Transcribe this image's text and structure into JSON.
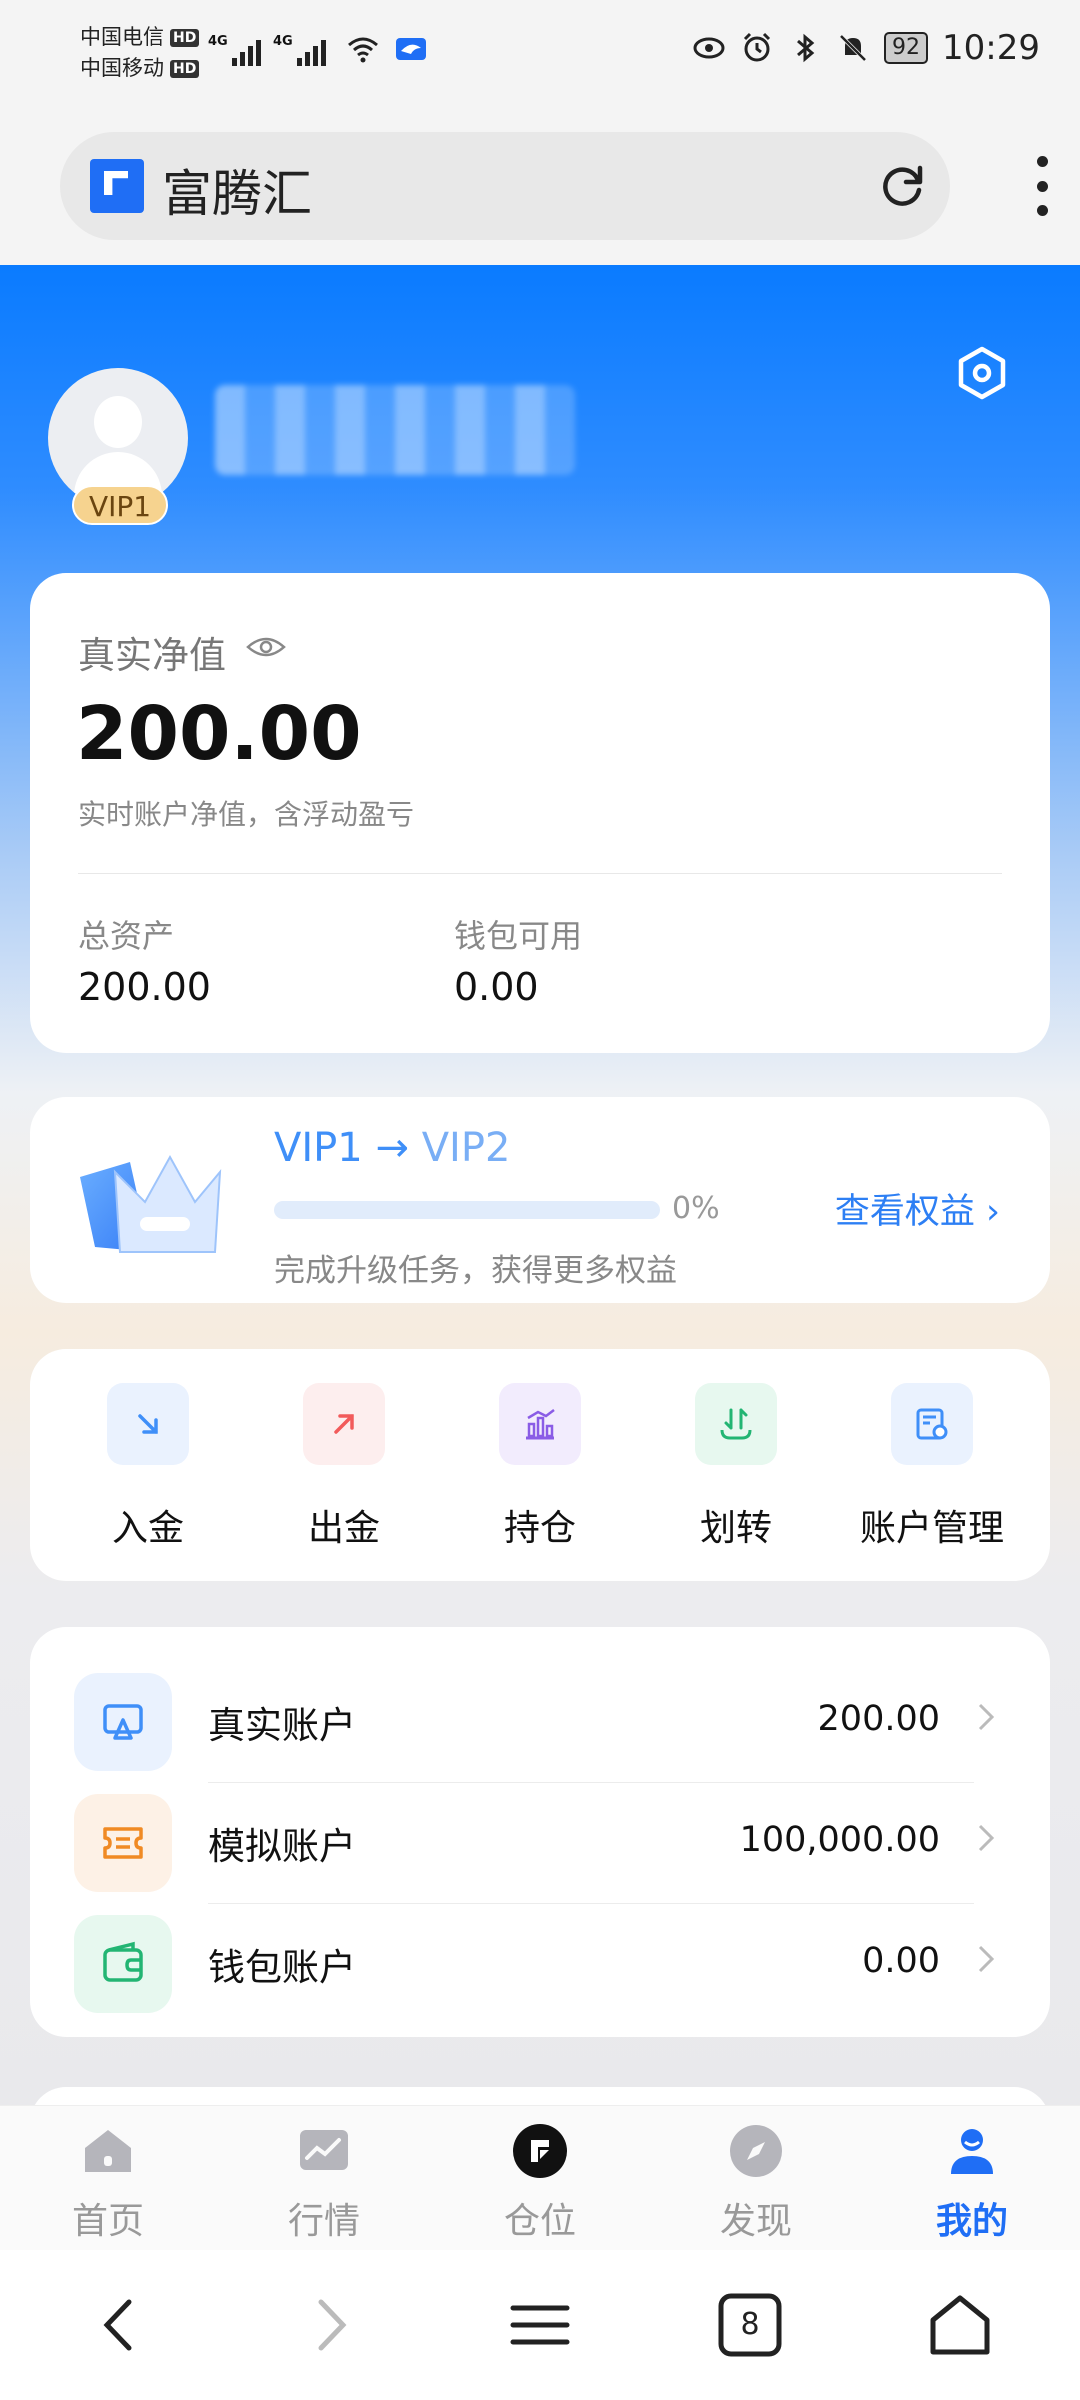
{
  "status_bar": {
    "carrier1": "中国电信",
    "carrier2": "中国移动",
    "hd": "HD",
    "network": "4G",
    "battery": "92",
    "time": "10:29"
  },
  "browser": {
    "site_title": "富腾汇",
    "icons": [
      "site-logo-icon",
      "reload-icon",
      "more-menu-icon"
    ]
  },
  "profile": {
    "vip_badge": "VIP1"
  },
  "net_value_card": {
    "label": "真实净值",
    "value": "200.00",
    "subtitle": "实时账户净值，含浮动盈亏",
    "total_assets_label": "总资产",
    "total_assets_value": "200.00",
    "wallet_available_label": "钱包可用",
    "wallet_available_value": "0.00"
  },
  "vip_card": {
    "current": "VIP1",
    "arrow": "→",
    "next": "VIP2",
    "progress": 0,
    "progress_text": "0%",
    "hint": "完成升级任务，获得更多权益",
    "link": "查看权益",
    "link_chevron": "›"
  },
  "actions": [
    {
      "label": "入金",
      "icon": "deposit-arrow-icon",
      "color": "#3f8ff8",
      "bg": "#eaf2fe"
    },
    {
      "label": "出金",
      "icon": "withdraw-arrow-icon",
      "color": "#f25b5b",
      "bg": "#fdeeee"
    },
    {
      "label": "持仓",
      "icon": "positions-chart-icon",
      "color": "#8a5ce6",
      "bg": "#f2ecfd"
    },
    {
      "label": "划转",
      "icon": "transfer-icon",
      "color": "#23b573",
      "bg": "#e7f8ef"
    },
    {
      "label": "账户管理",
      "icon": "account-manage-icon",
      "color": "#3f8ff8",
      "bg": "#eaf2fe"
    }
  ],
  "accounts": [
    {
      "name": "真实账户",
      "value": "200.00",
      "icon": "real-account-icon",
      "color": "#3f8ff8",
      "bg": "#eaf2fe"
    },
    {
      "name": "模拟账户",
      "value": "100,000.00",
      "icon": "demo-account-icon",
      "color": "#f08a24",
      "bg": "#fdf1e6"
    },
    {
      "name": "钱包账户",
      "value": "0.00",
      "icon": "wallet-account-icon",
      "color": "#23b573",
      "bg": "#e7f8ef"
    }
  ],
  "tabs": [
    {
      "label": "首页",
      "icon": "home-icon",
      "active": false
    },
    {
      "label": "行情",
      "icon": "market-icon",
      "active": false
    },
    {
      "label": "仓位",
      "icon": "position-icon",
      "active": false
    },
    {
      "label": "发现",
      "icon": "discover-icon",
      "active": false
    },
    {
      "label": "我的",
      "icon": "profile-icon",
      "active": true
    }
  ],
  "system_nav": {
    "tab_count": "8"
  },
  "colors": {
    "brand_blue": "#1f6ef5",
    "accent_blue": "#3f8ff8"
  }
}
